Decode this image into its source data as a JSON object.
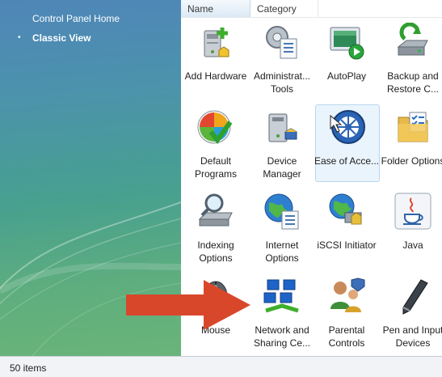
{
  "sidebar": {
    "links": [
      {
        "label": "Control Panel Home"
      },
      {
        "label": "Classic View"
      }
    ],
    "bullet": "•"
  },
  "columns": [
    {
      "label": "Name"
    },
    {
      "label": "Category"
    }
  ],
  "items": [
    {
      "label": "Add Hardware",
      "icon": "add-hardware-icon"
    },
    {
      "label": "Administrat... Tools",
      "icon": "administrative-tools-icon"
    },
    {
      "label": "AutoPlay",
      "icon": "autoplay-icon"
    },
    {
      "label": "Backup and Restore C...",
      "icon": "backup-restore-icon"
    },
    {
      "label": "Default Programs",
      "icon": "default-programs-icon"
    },
    {
      "label": "Device Manager",
      "icon": "device-manager-icon"
    },
    {
      "label": "Ease of Acce...",
      "icon": "ease-of-access-icon"
    },
    {
      "label": "Folder Options",
      "icon": "folder-options-icon"
    },
    {
      "label": "Indexing Options",
      "icon": "indexing-options-icon"
    },
    {
      "label": "Internet Options",
      "icon": "internet-options-icon"
    },
    {
      "label": "iSCSI Initiator",
      "icon": "iscsi-initiator-icon"
    },
    {
      "label": "Java",
      "icon": "java-icon"
    },
    {
      "label": "Mouse",
      "icon": "mouse-icon"
    },
    {
      "label": "Network and Sharing Ce...",
      "icon": "network-sharing-icon"
    },
    {
      "label": "Parental Controls",
      "icon": "parental-controls-icon"
    },
    {
      "label": "Pen and Input Devices",
      "icon": "pen-input-icon"
    }
  ],
  "status": {
    "count": "50 items"
  },
  "colors": {
    "arrow": "#d9472b",
    "sidebar_top": "#4f86b8",
    "sidebar_bottom": "#6ab47a"
  }
}
